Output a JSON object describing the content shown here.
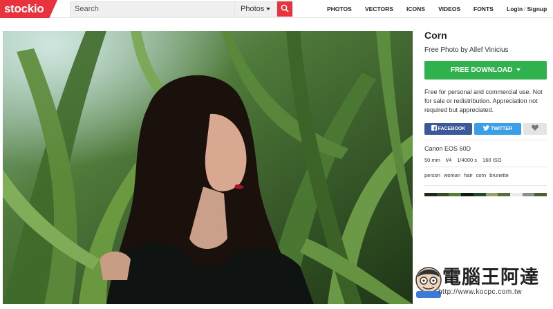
{
  "brand": {
    "logo_text": "stockio",
    "accent": "#e8323c"
  },
  "search": {
    "placeholder": "Search",
    "type_label": "Photos"
  },
  "nav": [
    "PHOTOS",
    "VECTORS",
    "ICONS",
    "VIDEOS",
    "FONTS"
  ],
  "auth": {
    "login": "Login",
    "separator": "/",
    "signup": "Signup"
  },
  "photo": {
    "subject": "woman with long dark hair among corn stalks"
  },
  "details": {
    "title": "Corn",
    "byline": "Free Photo by Allef Vinicius",
    "download_label": "FREE DOWNLOAD",
    "download_color": "#2fb24d",
    "license_text": "Free for personal and commercial use. Not for sale or redistribution. Appreciation not required but appreciated.",
    "share": {
      "facebook": "FACEBOOK",
      "twitter": "TWITTER"
    },
    "camera": "Canon EOS 60D",
    "exif": [
      "50 mm",
      "f/4",
      "1/4000 s",
      "160 ISO"
    ],
    "tags": [
      "person",
      "woman",
      "hair",
      "corn",
      "brunette"
    ],
    "palette": [
      "#1d2a17",
      "#344c22",
      "#567a3a",
      "#0e1a12",
      "#24462b",
      "#8fa36a",
      "#5c6b3c",
      "#e9ecec",
      "#8b8f86",
      "#4d5e30"
    ]
  },
  "watermark": {
    "text": "電腦王阿達",
    "url": "http://www.kocpc.com.tw"
  }
}
